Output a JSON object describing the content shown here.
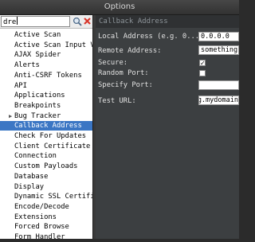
{
  "window": {
    "title": "Options"
  },
  "search": {
    "value": "dre"
  },
  "tree": {
    "items": [
      {
        "label": "Active Scan",
        "selected": false,
        "expandable": false
      },
      {
        "label": "Active Scan Input Vectors",
        "selected": false,
        "expandable": false
      },
      {
        "label": "AJAX Spider",
        "selected": false,
        "expandable": false
      },
      {
        "label": "Alerts",
        "selected": false,
        "expandable": false
      },
      {
        "label": "Anti-CSRF Tokens",
        "selected": false,
        "expandable": false
      },
      {
        "label": "API",
        "selected": false,
        "expandable": false
      },
      {
        "label": "Applications",
        "selected": false,
        "expandable": false
      },
      {
        "label": "Breakpoints",
        "selected": false,
        "expandable": false
      },
      {
        "label": "Bug Tracker",
        "selected": false,
        "expandable": true
      },
      {
        "label": "Callback Address",
        "selected": true,
        "expandable": false
      },
      {
        "label": "Check For Updates",
        "selected": false,
        "expandable": false
      },
      {
        "label": "Client Certificate",
        "selected": false,
        "expandable": false
      },
      {
        "label": "Connection",
        "selected": false,
        "expandable": false
      },
      {
        "label": "Custom Payloads",
        "selected": false,
        "expandable": false
      },
      {
        "label": "Database",
        "selected": false,
        "expandable": false
      },
      {
        "label": "Display",
        "selected": false,
        "expandable": false
      },
      {
        "label": "Dynamic SSL Certificates",
        "selected": false,
        "expandable": false
      },
      {
        "label": "Encode/Decode",
        "selected": false,
        "expandable": false
      },
      {
        "label": "Extensions",
        "selected": false,
        "expandable": false
      },
      {
        "label": "Forced Browse",
        "selected": false,
        "expandable": false
      },
      {
        "label": "Form Handler",
        "selected": false,
        "expandable": false
      }
    ]
  },
  "panel": {
    "title": "Callback Address",
    "local_address_label": "Local Address (e.g. 0...",
    "local_address_value": "0.0.0.0",
    "remote_address_label": "Remote Address:",
    "remote_address_value": "something.mydomain",
    "secure_label": "Secure:",
    "secure_checked": true,
    "random_port_label": "Random Port:",
    "random_port_checked": false,
    "specify_port_label": "Specify Port:",
    "specify_port_value": "",
    "test_url_label": "Test URL:",
    "test_url_value": "something.mydomain"
  },
  "colors": {
    "selection": "#3b76c4",
    "panel_bg": "#3c3f41",
    "clear_icon": "#d9362b"
  }
}
